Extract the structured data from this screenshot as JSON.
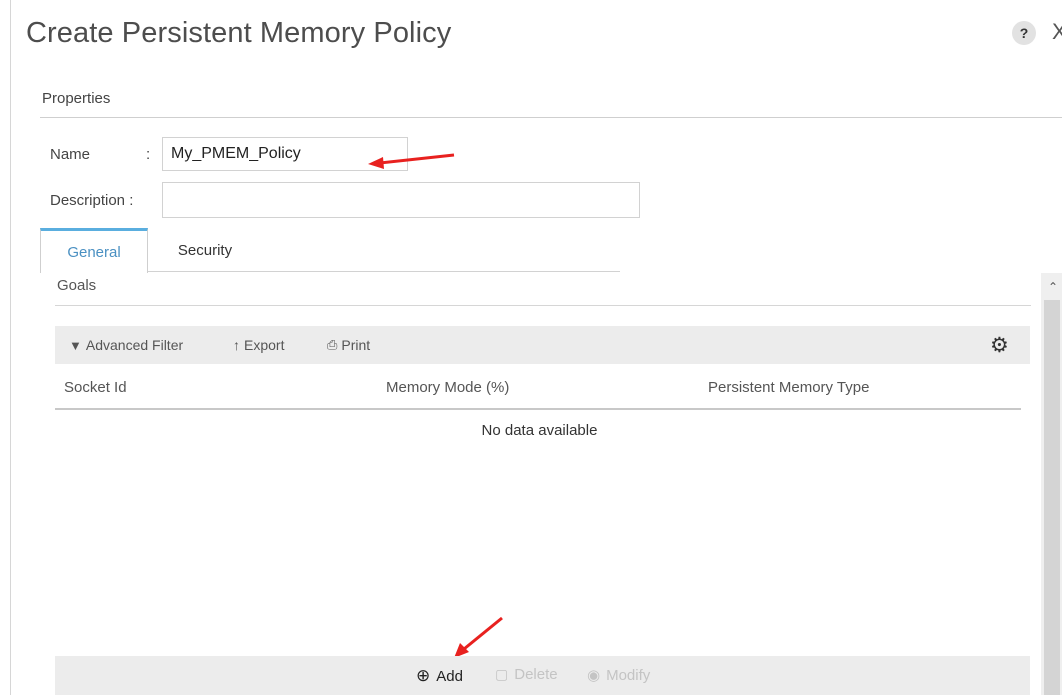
{
  "dialog": {
    "title": "Create Persistent Memory Policy",
    "help_label": "?",
    "close_label": "X"
  },
  "properties": {
    "section_label": "Properties",
    "name_label": "Name",
    "name_colon": ":",
    "name_value": "My_PMEM_Policy",
    "description_label": "Description :",
    "description_value": ""
  },
  "tabs": [
    {
      "label": "General",
      "active": true
    },
    {
      "label": "Security",
      "active": false
    }
  ],
  "goals": {
    "section_label": "Goals",
    "toolbar": {
      "advanced_filter": "Advanced Filter",
      "export": "Export",
      "print": "Print"
    },
    "columns": [
      "Socket Id",
      "Memory Mode (%)",
      "Persistent Memory Type"
    ],
    "empty_text": "No data available",
    "actions": {
      "add": "Add",
      "delete": "Delete",
      "modify": "Modify"
    }
  },
  "colors": {
    "accent_tab": "#5aaedf",
    "annotation_arrow": "#e8211f"
  },
  "icons": [
    "help-icon",
    "close-icon",
    "filter-icon",
    "export-icon",
    "print-icon",
    "gear-icon",
    "add-icon",
    "delete-icon",
    "modify-icon",
    "scroll-up-icon"
  ]
}
